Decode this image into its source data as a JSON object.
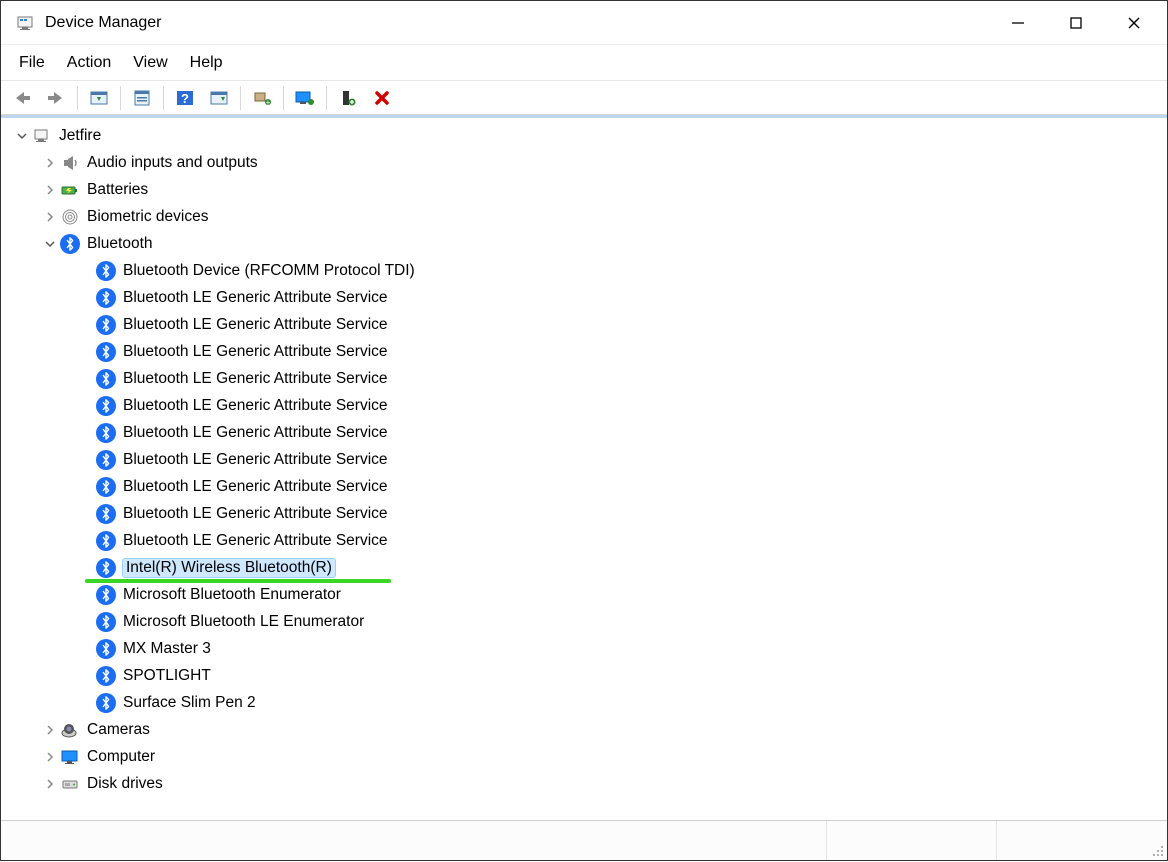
{
  "window": {
    "title": "Device Manager"
  },
  "menu": {
    "items": [
      "File",
      "Action",
      "View",
      "Help"
    ]
  },
  "toolbar": {
    "buttons": [
      "back",
      "forward",
      "sep",
      "properties-window",
      "sep",
      "properties",
      "sep",
      "help",
      "show-hidden",
      "sep",
      "scan-hardware",
      "sep",
      "update-driver",
      "sep",
      "uninstall",
      "delete"
    ]
  },
  "tree": {
    "root": {
      "label": "Jetfire",
      "expanded": true
    },
    "children": [
      {
        "label": "Audio inputs and outputs",
        "icon": "speaker",
        "expanded": false,
        "hasChildren": true
      },
      {
        "label": "Batteries",
        "icon": "battery",
        "expanded": false,
        "hasChildren": true
      },
      {
        "label": "Biometric devices",
        "icon": "fingerprint",
        "expanded": false,
        "hasChildren": true
      },
      {
        "label": "Bluetooth",
        "icon": "bluetooth",
        "expanded": true,
        "hasChildren": true,
        "children": [
          {
            "label": "Bluetooth Device (RFCOMM Protocol TDI)",
            "icon": "bluetooth"
          },
          {
            "label": "Bluetooth LE Generic Attribute Service",
            "icon": "bluetooth"
          },
          {
            "label": "Bluetooth LE Generic Attribute Service",
            "icon": "bluetooth"
          },
          {
            "label": "Bluetooth LE Generic Attribute Service",
            "icon": "bluetooth"
          },
          {
            "label": "Bluetooth LE Generic Attribute Service",
            "icon": "bluetooth"
          },
          {
            "label": "Bluetooth LE Generic Attribute Service",
            "icon": "bluetooth"
          },
          {
            "label": "Bluetooth LE Generic Attribute Service",
            "icon": "bluetooth"
          },
          {
            "label": "Bluetooth LE Generic Attribute Service",
            "icon": "bluetooth"
          },
          {
            "label": "Bluetooth LE Generic Attribute Service",
            "icon": "bluetooth"
          },
          {
            "label": "Bluetooth LE Generic Attribute Service",
            "icon": "bluetooth"
          },
          {
            "label": "Bluetooth LE Generic Attribute Service",
            "icon": "bluetooth"
          },
          {
            "label": "Intel(R) Wireless Bluetooth(R)",
            "icon": "bluetooth",
            "selected": true,
            "underlined": true
          },
          {
            "label": "Microsoft Bluetooth Enumerator",
            "icon": "bluetooth"
          },
          {
            "label": "Microsoft Bluetooth LE Enumerator",
            "icon": "bluetooth"
          },
          {
            "label": "MX Master 3",
            "icon": "bluetooth"
          },
          {
            "label": "SPOTLIGHT",
            "icon": "bluetooth"
          },
          {
            "label": "Surface Slim Pen 2",
            "icon": "bluetooth"
          }
        ]
      },
      {
        "label": "Cameras",
        "icon": "camera",
        "expanded": false,
        "hasChildren": true
      },
      {
        "label": "Computer",
        "icon": "monitor",
        "expanded": false,
        "hasChildren": true
      },
      {
        "label": "Disk drives",
        "icon": "disk",
        "expanded": false,
        "hasChildren": true
      }
    ]
  },
  "annotation": {
    "underline_color": "#3ad625"
  }
}
